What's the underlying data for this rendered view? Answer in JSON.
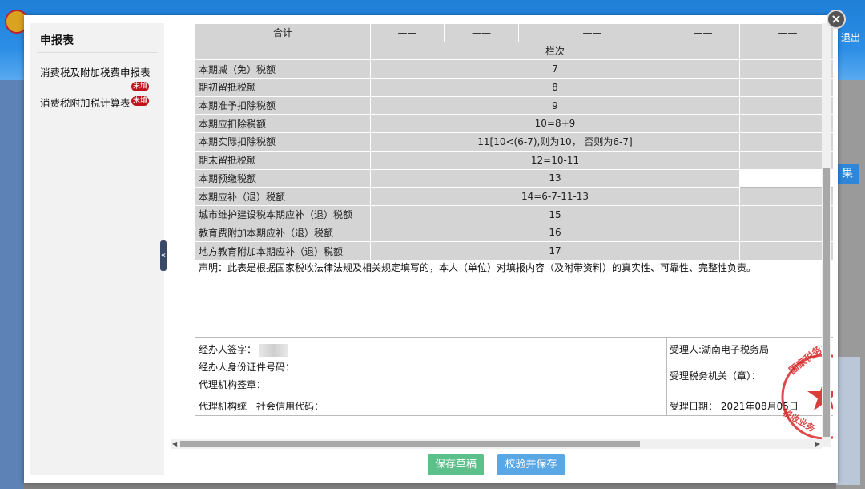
{
  "app": {
    "exit_label": "退出"
  },
  "background": {
    "result_button_label": "果"
  },
  "close_label": "×",
  "sidebar": {
    "title": "申报表",
    "items": [
      {
        "label": "消费税及附加税费申报表",
        "badge": "未填"
      },
      {
        "label": "消费税附加税计算表",
        "badge": "未填"
      }
    ],
    "collapse_label": "«"
  },
  "table": {
    "total_row": {
      "label": "合计",
      "values": [
        "——",
        "——",
        "——",
        "——",
        "——"
      ]
    },
    "column_header": "栏次",
    "rows": [
      {
        "label": "本期减（免）税额",
        "code": "7"
      },
      {
        "label": "期初留抵税额",
        "code": "8"
      },
      {
        "label": "本期准予扣除税额",
        "code": "9"
      },
      {
        "label": "本期应扣除税额",
        "code": "10=8+9"
      },
      {
        "label": "本期实际扣除税额",
        "code": "11[10<(6-7),则为10， 否则为6-7]"
      },
      {
        "label": "期末留抵税额",
        "code": "12=10-11"
      },
      {
        "label": "本期预缴税额",
        "code": "13"
      },
      {
        "label": "本期应补（退）税额",
        "code": "14=6-7-11-13"
      },
      {
        "label": "城市维护建设税本期应补（退）税额",
        "code": "15"
      },
      {
        "label": "教育费附加本期应补（退）税额",
        "code": "16"
      },
      {
        "label": "地方教育附加本期应补（退）税额",
        "code": "17"
      }
    ]
  },
  "declaration": "声明：此表是根据国家税收法律法规及相关规定填写的，本人（单位）对填报内容（及附带资料）的真实性、可靠性、完整性负责。",
  "signature": {
    "handler_sign": "经办人签字：",
    "handler_id": "经办人身份证件号码：",
    "agency_seal": "代理机构签章：",
    "agency_code": "代理机构统一社会信用代码：",
    "receiver": "受理人:湖南电子税务局",
    "tax_office": "受理税务机关（章）：",
    "receive_date": "受理日期：  2021年08月05日"
  },
  "seal": {
    "text": "国家税务总局湖南省税收业务专用章",
    "color": "#d62a2a"
  },
  "buttons": {
    "save_draft": "保存草稿",
    "validate_save": "校验并保存"
  }
}
